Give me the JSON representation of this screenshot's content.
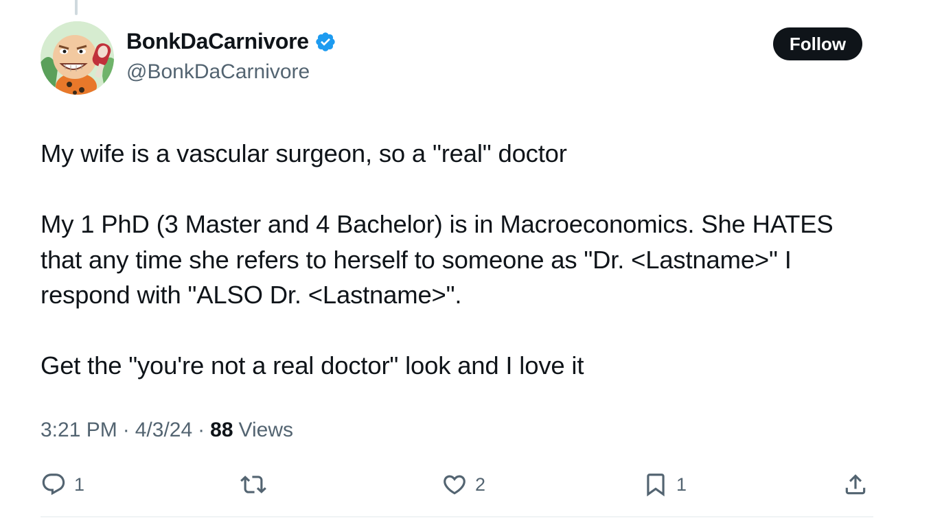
{
  "author": {
    "display_name": "BonkDaCarnivore",
    "handle": "@BonkDaCarnivore",
    "verified": true
  },
  "follow_label": "Follow",
  "tweet": {
    "paragraphs": [
      "My wife is a vascular surgeon, so a \"real\" doctor",
      "My 1 PhD (3 Master and 4 Bachelor) is in Macroeconomics. She HATES that any time she refers to herself to someone as \"Dr. <Lastname>\" I respond with \"ALSO Dr. <Lastname>\".",
      "Get the \"you're not a real doctor\" look and I love it"
    ]
  },
  "meta": {
    "time": "3:21 PM",
    "separator": "·",
    "date": "4/3/24",
    "views_count": "88",
    "views_label": "Views"
  },
  "actions": {
    "reply": {
      "icon": "reply-icon",
      "count": "1"
    },
    "retweet": {
      "icon": "retweet-icon",
      "count": ""
    },
    "like": {
      "icon": "heart-icon",
      "count": "2"
    },
    "bookmark": {
      "icon": "bookmark-icon",
      "count": "1"
    },
    "share": {
      "icon": "share-icon"
    }
  },
  "colors": {
    "text": "#0f1419",
    "secondary": "#536471",
    "verified": "#1d9bf0",
    "follow_bg": "#0f1419",
    "divider": "#eff3f4"
  }
}
